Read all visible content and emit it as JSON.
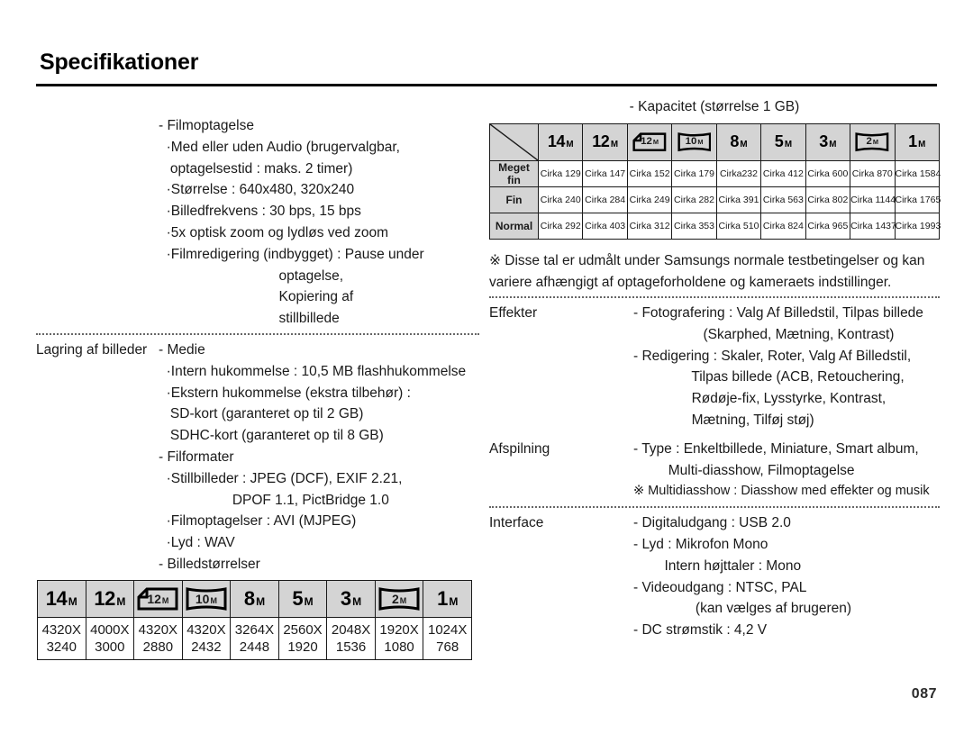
{
  "page": {
    "title": "Specifikationer",
    "number": "087"
  },
  "left_column": {
    "block1": {
      "label": "",
      "lines": [
        "- Filmoptagelse",
        "  ·Med eller uden Audio (brugervalgbar,",
        "   optagelsestid : maks. 2 timer)",
        "  ·Størrelse : 640x480, 320x240",
        "  ·Billedfrekvens : 30 bps, 15 bps",
        "  ·5x optisk zoom og lydløs ved zoom",
        "  ·Filmredigering (indbygget) : Pause under",
        "                               optagelse,",
        "                               Kopiering af",
        "                               stillbillede"
      ]
    },
    "block2": {
      "label": "Lagring af billeder",
      "lines": [
        "- Medie",
        "  ·Intern hukommelse : 10,5 MB flashhukommelse",
        "  ·Ekstern hukommelse (ekstra tilbehør) :",
        "   SD-kort (garanteret op til 2 GB)",
        "   SDHC-kort (garanteret op til 8 GB)",
        "- Filformater",
        "  ·Stillbilleder : JPEG (DCF), EXIF 2.21,",
        "                   DPOF 1.1, PictBridge 1.0",
        "  ·Filmoptagelser : AVI (MJPEG)",
        "  ·Lyd : WAV",
        "- Billedstørrelser"
      ]
    }
  },
  "size_table": {
    "headers": [
      {
        "value": "14",
        "unit": "M",
        "icon": "res-plain-icon"
      },
      {
        "value": "12",
        "unit": "M",
        "icon": "res-plain-icon"
      },
      {
        "value": "12",
        "unit": "M",
        "icon": "res-foldedcorner-icon"
      },
      {
        "value": "10",
        "unit": "M",
        "icon": "res-wide-icon"
      },
      {
        "value": "8",
        "unit": "M",
        "icon": "res-plain-icon"
      },
      {
        "value": "5",
        "unit": "M",
        "icon": "res-plain-icon"
      },
      {
        "value": "3",
        "unit": "M",
        "icon": "res-plain-icon"
      },
      {
        "value": "2",
        "unit": "M",
        "icon": "res-wide-icon"
      },
      {
        "value": "1",
        "unit": "M",
        "icon": "res-plain-icon"
      }
    ],
    "values": [
      [
        "4320X",
        "3240"
      ],
      [
        "4000X",
        "3000"
      ],
      [
        "4320X",
        "2880"
      ],
      [
        "4320X",
        "2432"
      ],
      [
        "3264X",
        "2448"
      ],
      [
        "2560X",
        "1920"
      ],
      [
        "2048X",
        "1536"
      ],
      [
        "1920X",
        "1080"
      ],
      [
        "1024X",
        "768"
      ]
    ]
  },
  "right_column": {
    "capacity": {
      "caption": "- Kapacitet (størrelse 1 GB)",
      "headers": [
        {
          "value": "14",
          "unit": "M",
          "icon": "res-plain-icon"
        },
        {
          "value": "12",
          "unit": "M",
          "icon": "res-plain-icon"
        },
        {
          "value": "12",
          "unit": "M",
          "icon": "res-foldedcorner-icon"
        },
        {
          "value": "10",
          "unit": "M",
          "icon": "res-wide-icon"
        },
        {
          "value": "8",
          "unit": "M",
          "icon": "res-plain-icon"
        },
        {
          "value": "5",
          "unit": "M",
          "icon": "res-plain-icon"
        },
        {
          "value": "3",
          "unit": "M",
          "icon": "res-plain-icon"
        },
        {
          "value": "2",
          "unit": "M",
          "icon": "res-wide-icon"
        },
        {
          "value": "1",
          "unit": "M",
          "icon": "res-plain-icon"
        }
      ],
      "rows": [
        {
          "label": "Meget fin",
          "cells": [
            "Cirka 129",
            "Cirka 147",
            "Cirka 152",
            "Cirka 179",
            "Cirka232",
            "Cirka 412",
            "Cirka 600",
            "Cirka 870",
            "Cirka 1584"
          ]
        },
        {
          "label": "Fin",
          "cells": [
            "Cirka 240",
            "Cirka 284",
            "Cirka 249",
            "Cirka 282",
            "Cirka 391",
            "Cirka 563",
            "Cirka 802",
            "Cirka 1144",
            "Cirka 1765"
          ]
        },
        {
          "label": "Normal",
          "cells": [
            "Cirka 292",
            "Cirka 403",
            "Cirka 312",
            "Cirka 353",
            "Cirka 510",
            "Cirka 824",
            "Cirka 965",
            "Cirka 1437",
            "Cirka 1993"
          ]
        }
      ]
    },
    "note": [
      "※ Disse tal er udmålt under Samsungs normale testbetingelser og kan",
      "  variere afhængigt af optageforholdene og kameraets indstillinger."
    ],
    "block_effekter": {
      "label": "Effekter",
      "lines": [
        "- Fotografering : Valg Af Billedstil, Tilpas billede",
        "                  (Skarphed, Mætning, Kontrast)",
        "- Redigering : Skaler, Roter, Valg Af Billedstil,",
        "               Tilpas billede (ACB, Retouchering,",
        "               Rødøje-fix, Lysstyrke, Kontrast,",
        "               Mætning, Tilføj støj)"
      ]
    },
    "block_afspilning": {
      "label": "Afspilning",
      "lines": [
        "- Type : Enkeltbillede, Miniature, Smart album,",
        "         Multi-diasshow, Filmoptagelse"
      ],
      "footnote": "※ Multidiasshow : Diasshow med effekter og musik"
    },
    "block_interface": {
      "label": "Interface",
      "lines": [
        "- Digitaludgang : USB 2.0",
        "- Lyd : Mikrofon Mono",
        "        Intern højttaler : Mono",
        "- Videoudgang : NTSC, PAL",
        "                (kan vælges af brugeren)",
        "- DC strømstik : 4,2 V"
      ]
    }
  }
}
